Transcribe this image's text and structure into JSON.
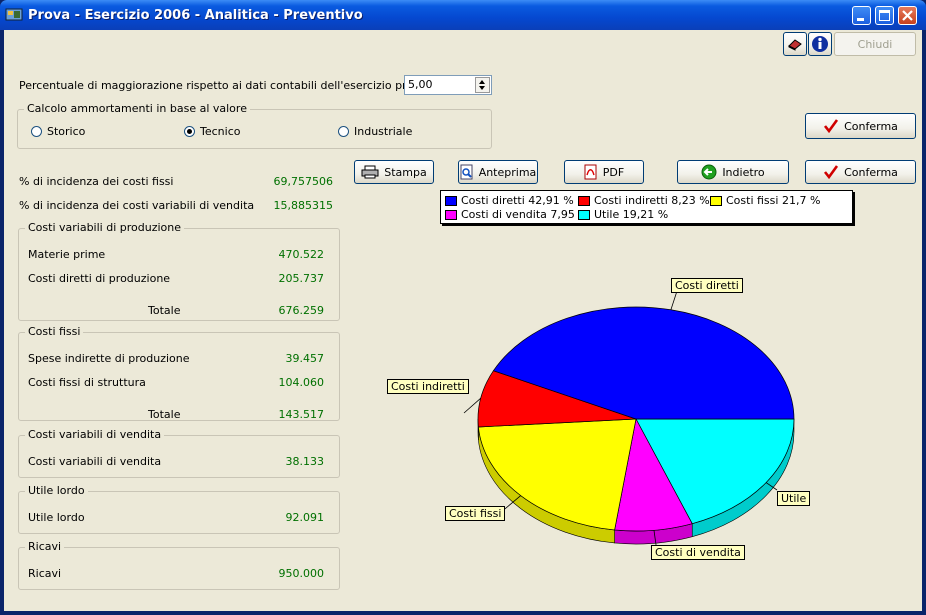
{
  "window": {
    "title": "Prova - Esercizio 2006 - Analitica - Preventivo"
  },
  "toolbar": {
    "close_label": "Chiudi"
  },
  "percent": {
    "label": "Percentuale di maggiorazione rispetto ai dati contabili dell'esercizio precedente",
    "value": "5,00"
  },
  "ammortamenti": {
    "title": "Calcolo ammortamenti in base al valore",
    "options": [
      {
        "label": "Storico",
        "selected": false
      },
      {
        "label": "Tecnico",
        "selected": true
      },
      {
        "label": "Industriale",
        "selected": false
      }
    ],
    "confirm_label": "Conferma"
  },
  "actions": {
    "stampa": "Stampa",
    "anteprima": "Anteprima",
    "pdf": "PDF",
    "indietro": "Indietro",
    "conferma": "Conferma"
  },
  "incidenza": {
    "fissi_label": "% di incidenza dei costi fissi",
    "fissi_value": "69,757506",
    "vendita_label": "% di incidenza dei costi variabili di vendita",
    "vendita_value": "15,885315"
  },
  "groups": {
    "var_prod": {
      "title": "Costi variabili di produzione",
      "rows": [
        {
          "label": "Materie prime",
          "value": "470.522"
        },
        {
          "label": "Costi diretti di produzione",
          "value": "205.737"
        }
      ],
      "total_label": "Totale",
      "total_value": "676.259"
    },
    "fissi": {
      "title": "Costi fissi",
      "rows": [
        {
          "label": "Spese indirette di produzione",
          "value": "39.457"
        },
        {
          "label": "Costi fissi di struttura",
          "value": "104.060"
        }
      ],
      "total_label": "Totale",
      "total_value": "143.517"
    },
    "var_vend": {
      "title": "Costi variabili di vendita",
      "rows": [
        {
          "label": "Costi variabili di vendita",
          "value": "38.133"
        }
      ]
    },
    "utile": {
      "title": "Utile lordo",
      "rows": [
        {
          "label": "Utile lordo",
          "value": "92.091"
        }
      ]
    },
    "ricavi": {
      "title": "Ricavi",
      "rows": [
        {
          "label": "Ricavi",
          "value": "950.000"
        }
      ]
    }
  },
  "chart_data": {
    "type": "pie",
    "series": [
      {
        "name": "Costi diretti",
        "legend": "Costi diretti 42,91 %",
        "value": 42.91,
        "color": "#0000ff"
      },
      {
        "name": "Costi indiretti",
        "legend": "Costi indiretti 8,23 %",
        "value": 8.23,
        "color": "#ff0000"
      },
      {
        "name": "Costi fissi",
        "legend": "Costi fissi 21,7 %",
        "value": 21.7,
        "color": "#ffff00"
      },
      {
        "name": "Costi di vendita",
        "legend": "Costi di vendita 7,95 %",
        "value": 7.95,
        "color": "#ff00ff"
      },
      {
        "name": "Utile",
        "legend": "Utile 19,21 %",
        "value": 19.21,
        "color": "#00ffff"
      }
    ],
    "legend_position": "top"
  }
}
